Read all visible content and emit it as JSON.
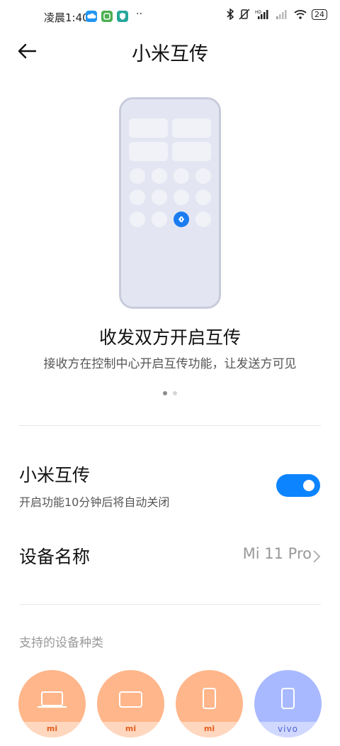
{
  "status_bar": {
    "time": "凌晨1:40",
    "battery": "24"
  },
  "header": {
    "title": "小米互传"
  },
  "intro": {
    "heading": "收发双方开启互传",
    "description": "接收方在控制中心开启互传功能，让发送方可见",
    "page_index": 1,
    "page_count": 2
  },
  "settings": {
    "share": {
      "title": "小米互传",
      "subtitle": "开启功能10分钟后将自动关闭",
      "enabled": true
    },
    "device_name": {
      "label": "设备名称",
      "value": "Mi 11 Pro"
    }
  },
  "supported": {
    "label": "支持的设备种类",
    "devices": [
      {
        "icon": "laptop-icon",
        "brand": "mi",
        "color": "#ffb68a"
      },
      {
        "icon": "tablet-icon",
        "brand": "mi",
        "color": "#ffb68a"
      },
      {
        "icon": "phone-icon",
        "brand": "mi",
        "color": "#ffb68a"
      },
      {
        "icon": "phone-icon",
        "brand": "vivo",
        "color": "#a9b9ff"
      }
    ]
  },
  "colors": {
    "accent": "#0d84ff",
    "illustration": "#dde1ee",
    "xiaomi_orange": "#ffb68a",
    "vivo_blue": "#a9b9ff"
  }
}
